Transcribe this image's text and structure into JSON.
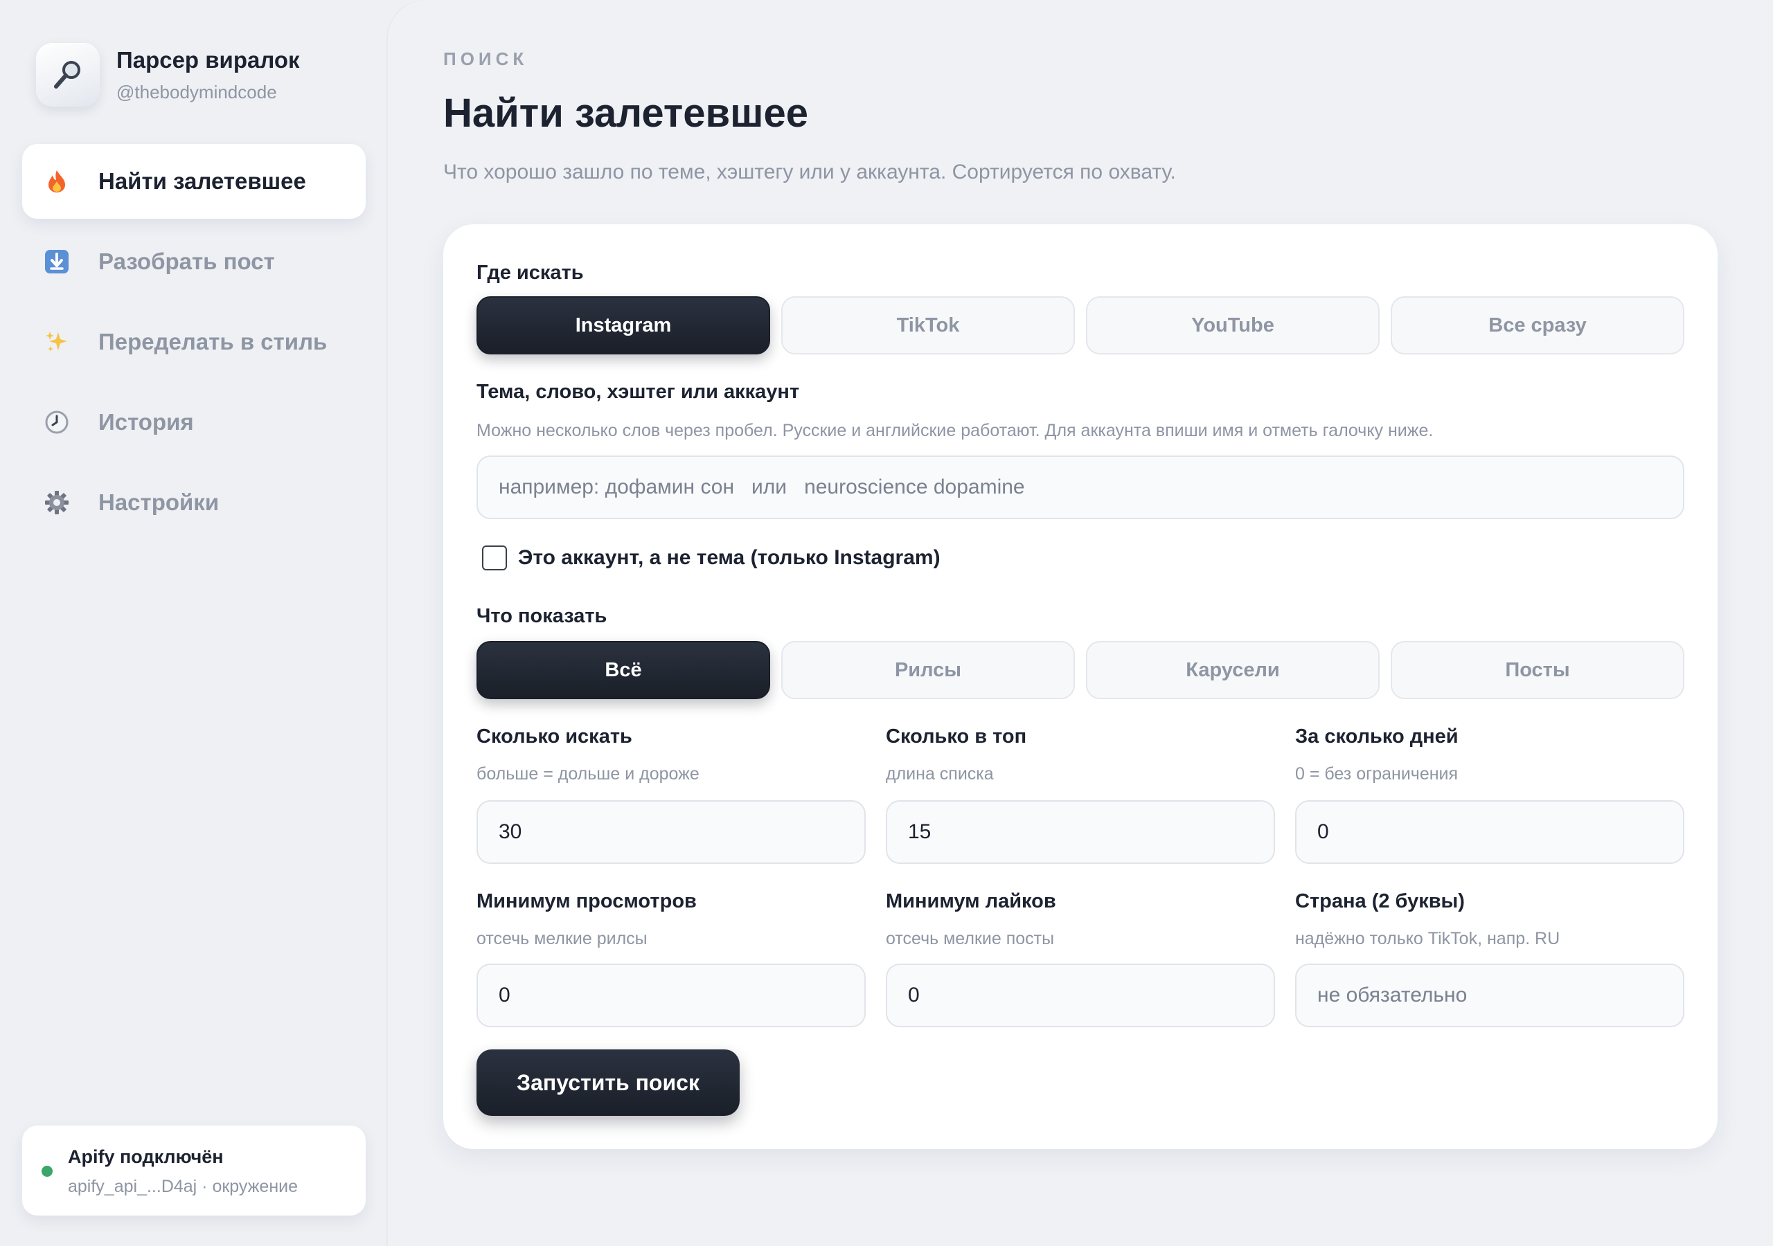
{
  "brand": {
    "title": "Парсер виралок",
    "handle": "@thebodymindcode",
    "logo_icon": "magnifier-icon"
  },
  "nav": {
    "items": [
      {
        "label": "Найти залетевшее",
        "icon": "fire-icon",
        "active": true
      },
      {
        "label": "Разобрать пост",
        "icon": "download-icon",
        "active": false
      },
      {
        "label": "Переделать в стиль",
        "icon": "sparkles-icon",
        "active": false
      },
      {
        "label": "История",
        "icon": "clock-icon",
        "active": false
      },
      {
        "label": "Настройки",
        "icon": "gear-icon",
        "active": false
      }
    ]
  },
  "status": {
    "title": "Apify подключён",
    "detail": "apify_api_...D4aj · окружение",
    "color": "#3aa66a"
  },
  "page": {
    "eyebrow": "ПОИСК",
    "title": "Найти залетевшее",
    "subtitle": "Что хорошо зашло по теме, хэштегу или у аккаунта. Сортируется по охвату."
  },
  "form": {
    "where": {
      "label": "Где искать",
      "options": [
        "Instagram",
        "TikTok",
        "YouTube",
        "Все сразу"
      ],
      "selected": "Instagram"
    },
    "query": {
      "label": "Тема, слово, хэштег или аккаунт",
      "help": "Можно несколько слов через пробел. Русские и английские работают. Для аккаунта впиши имя и отметь галочку ниже.",
      "placeholder": "например: дофамин сон   или   neuroscience dopamine",
      "value": ""
    },
    "account_checkbox": {
      "label": "Это аккаунт, а не тема (только Instagram)",
      "checked": false
    },
    "show": {
      "label": "Что показать",
      "options": [
        "Всё",
        "Рилсы",
        "Карусели",
        "Посты"
      ],
      "selected": "Всё"
    },
    "count": {
      "label": "Сколько искать",
      "help": "больше = дольше и дороже",
      "value": "30"
    },
    "top": {
      "label": "Сколько в топ",
      "help": "длина списка",
      "value": "15"
    },
    "days": {
      "label": "За сколько дней",
      "help": "0 = без ограничения",
      "value": "0"
    },
    "min_views": {
      "label": "Минимум просмотров",
      "help": "отсечь мелкие рилсы",
      "value": "0"
    },
    "min_likes": {
      "label": "Минимум лайков",
      "help": "отсечь мелкие посты",
      "value": "0"
    },
    "country": {
      "label": "Страна (2 буквы)",
      "help": "надёжно только TikTok, напр. RU",
      "placeholder": "не обязательно",
      "value": ""
    },
    "submit_label": "Запустить поиск"
  },
  "colors": {
    "accent_dark": "#1c2230",
    "muted": "#8e95a3",
    "background": "#eef0f4"
  }
}
